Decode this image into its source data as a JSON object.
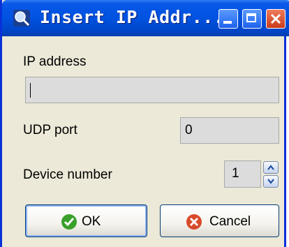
{
  "window": {
    "title": "Insert IP Addr...",
    "controls": {
      "minimize": "minimize-icon",
      "maximize": "maximize-icon",
      "close": "close-icon"
    }
  },
  "form": {
    "ip_label": "IP address",
    "ip_value": "",
    "udp_label": "UDP port",
    "udp_value": "0",
    "device_label": "Device number",
    "device_value": "1"
  },
  "buttons": {
    "ok_label": "OK",
    "cancel_label": "Cancel"
  },
  "colors": {
    "titlebar": "#0052e0",
    "dialog_bg": "#ece9d8",
    "field_bg": "#dcdcdc",
    "ok_icon": "#3aa02c",
    "cancel_icon": "#d84a2a"
  }
}
